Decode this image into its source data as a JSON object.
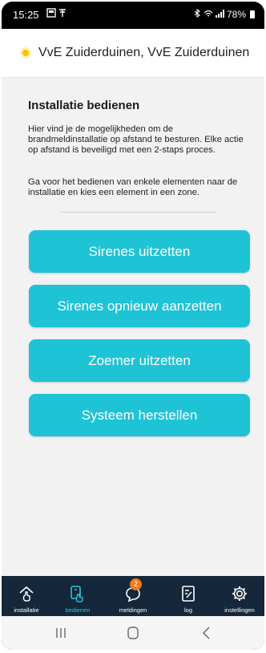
{
  "status": {
    "time": "15:25",
    "battery": "78%"
  },
  "header": {
    "title": "VvE Zuiderduinen, VvE Zuiderduinen"
  },
  "main": {
    "title": "Installatie bedienen",
    "paragraph1": "Hier vind je de mogelijkheden om de brandmeldinstallatie op afstand te besturen. Elke actie op afstand is beveiligd met een 2-staps proces.",
    "paragraph2": "Ga voor het bedienen van enkele elementen naar de installatie en kies een element in een zone.",
    "buttons": [
      "Sirenes uitzetten",
      "Sirenes opnieuw aanzetten",
      "Zoemer uitzetten",
      "Systeem herstellen"
    ]
  },
  "nav": {
    "items": [
      {
        "label": "installatie",
        "icon": "home-touch-icon"
      },
      {
        "label": "bedienen",
        "icon": "remote-touch-icon"
      },
      {
        "label": "meldingen",
        "icon": "chat-bubble-icon",
        "badge": "2"
      },
      {
        "label": "log",
        "icon": "log-edit-icon"
      },
      {
        "label": "instellingen",
        "icon": "gear-icon"
      }
    ],
    "active_index": 1
  },
  "colors": {
    "accent": "#1fc3d6",
    "nav_bg": "#15273a",
    "badge": "#f07b20",
    "sun": "#f4c400"
  }
}
